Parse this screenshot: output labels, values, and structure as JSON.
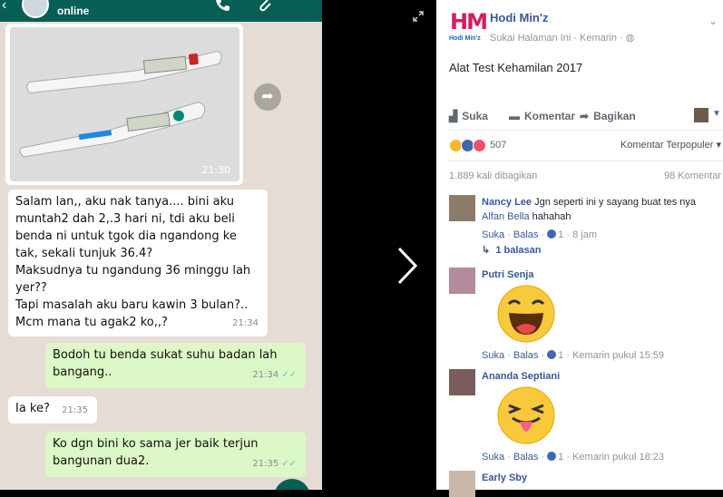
{
  "chat": {
    "status": "online",
    "image_time": "21:30",
    "messages": [
      {
        "dir": "in",
        "text": "Salam lan,, aku nak tanya.... bini aku\nmuntah2 dah 2,.3 hari ni, tdi aku beli\nbenda ni untuk tgok dia ngandong ke\ntak, sekali tunjuk 36.4?\nMaksudnya tu ngandung 36 minggu lah\nyer??\nTapi masalah aku baru kawin 3 bulan?..\nMcm mana tu agak2 ko,,?",
        "time": "21:34"
      },
      {
        "dir": "out",
        "text": "Bodoh tu benda sukat suhu badan lah\nbangang..",
        "time": "21:34"
      },
      {
        "dir": "in",
        "text": "Ia ke?",
        "time": "21:35"
      },
      {
        "dir": "out",
        "text": "Ko dgn bini ko sama jer baik terjun\nbangunan dua2.",
        "time": "21:35"
      }
    ]
  },
  "post": {
    "logo_text": "HM",
    "logo_sub": "Hodi Min'z",
    "page_name": "Hodi Min'z",
    "meta": "Sukai Halaman Ini · Kemarin ·",
    "text": "Alat Test Kehamilan 2017",
    "actions": {
      "like": "Suka",
      "comment": "Komentar",
      "share": "Bagikan"
    },
    "reactions_count": "507",
    "sort_label": "Komentar Terpopuler",
    "shares": "1.889 kali dibagikan",
    "comments_count": "98 Komentar"
  },
  "comments": [
    {
      "name": "Nancy Lee",
      "text": "Jgn seperti ini y sayang buat tes nya",
      "tag": "Alfan Bella",
      "tag_text": "hahahah",
      "like": "Suka",
      "reply": "Balas",
      "likes": "1",
      "time": "8 jam",
      "replies": "1 balasan"
    },
    {
      "name": "Putri Senja",
      "like": "Suka",
      "reply": "Balas",
      "likes": "1",
      "time": "Kemarin pukul 15:59"
    },
    {
      "name": "Ananda Septiani",
      "like": "Suka",
      "reply": "Balas",
      "likes": "1",
      "time": "Kemarin pukul 18:23"
    },
    {
      "name": "Early Sby"
    }
  ],
  "colors": {
    "whatsapp_green": "#075e54",
    "facebook_link": "#365899",
    "logo_pink": "#d81b60"
  },
  "icons": [
    "back-arrow-icon",
    "phone-icon",
    "paperclip-icon",
    "share-arrow-icon",
    "expand-icon",
    "chevron-right-icon",
    "like-thumb-icon",
    "comment-icon",
    "share-icon",
    "reply-arrow-icon"
  ]
}
